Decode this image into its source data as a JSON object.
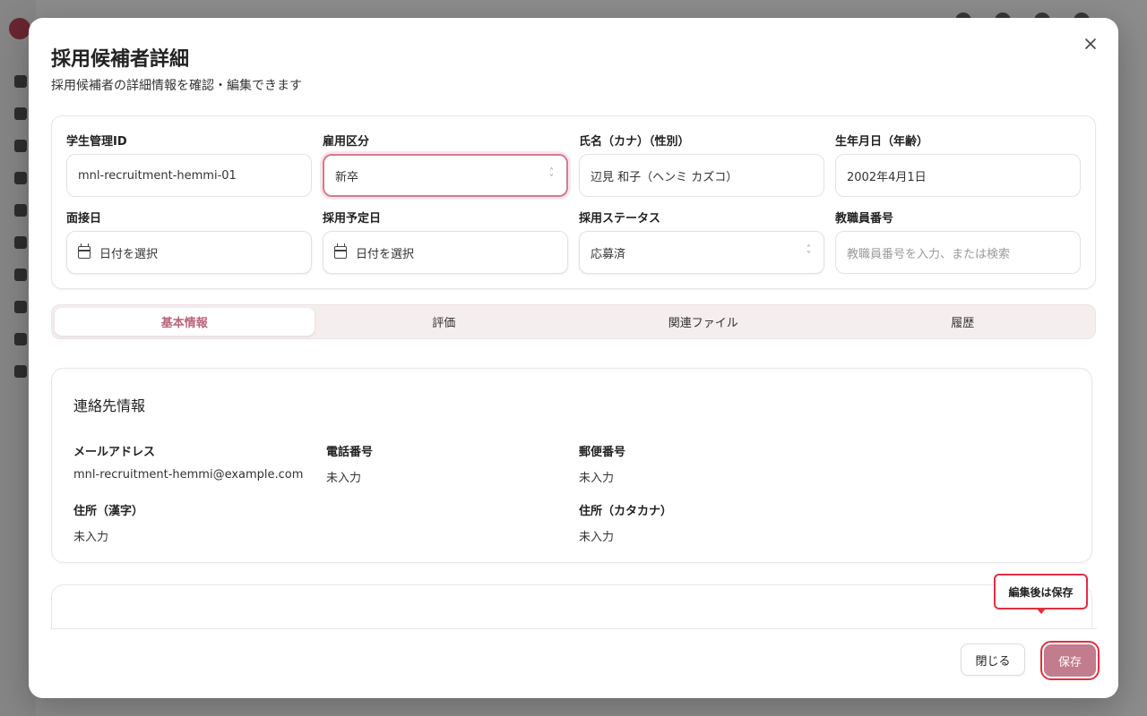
{
  "modal": {
    "title": "採用候補者詳細",
    "description": "採用候補者の詳細情報を確認・編集できます",
    "close_icon": "close-icon"
  },
  "form": {
    "student_id": {
      "label": "学生管理ID",
      "value": "mnl-recruitment-hemmi-01"
    },
    "employment_type": {
      "label": "雇用区分",
      "value": "新卒"
    },
    "name": {
      "label": "氏名（カナ）（性別）",
      "value": "辺見 和子（ヘンミ カズコ）"
    },
    "birthdate": {
      "label": "生年月日（年齢）",
      "value": "2002年4月1日"
    },
    "interview_date": {
      "label": "面接日",
      "placeholder": "日付を選択"
    },
    "hire_date": {
      "label": "採用予定日",
      "placeholder": "日付を選択"
    },
    "status": {
      "label": "採用ステータス",
      "value": "応募済"
    },
    "staff_number": {
      "label": "教職員番号",
      "placeholder": "教職員番号を入力、または検索"
    }
  },
  "tabs": [
    {
      "label": "基本情報",
      "active": true
    },
    {
      "label": "評価",
      "active": false
    },
    {
      "label": "関連ファイル",
      "active": false
    },
    {
      "label": "履歴",
      "active": false
    }
  ],
  "contact": {
    "title": "連絡先情報",
    "email": {
      "label": "メールアドレス",
      "value": "mnl-recruitment-hemmi@example.com"
    },
    "phone": {
      "label": "電話番号",
      "value": "未入力"
    },
    "postal": {
      "label": "郵便番号",
      "value": "未入力"
    },
    "address_kanji": {
      "label": "住所（漢字）",
      "value": "未入力"
    },
    "address_kana": {
      "label": "住所（カタカナ）",
      "value": "未入力"
    }
  },
  "footer": {
    "close_label": "閉じる",
    "save_label": "保存",
    "tooltip": "編集後は保存"
  },
  "colors": {
    "accent": "#c27c8c",
    "highlight": "#e0303e",
    "tab_active_text": "#b9647a"
  }
}
